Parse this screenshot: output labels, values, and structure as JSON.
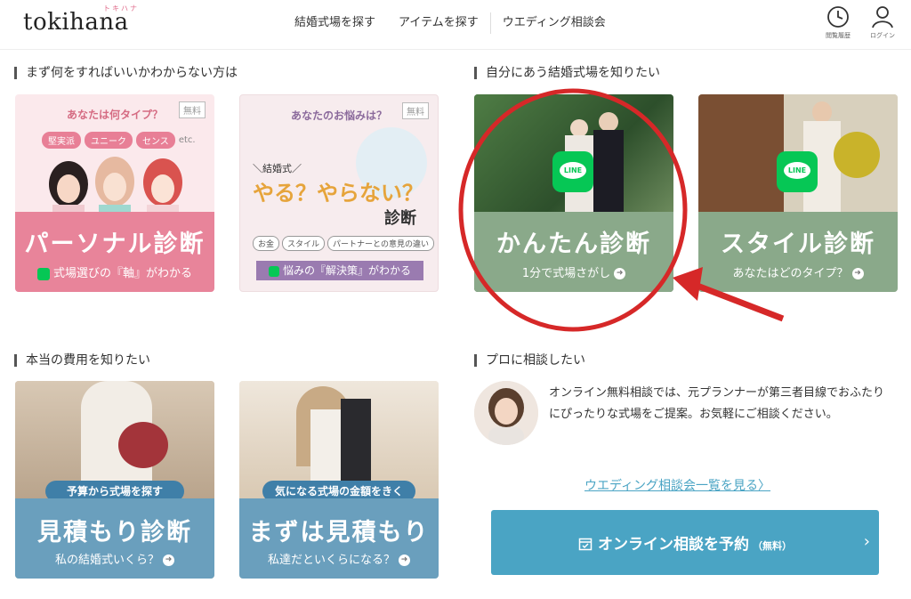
{
  "header": {
    "logo": "tokihana",
    "logo_kana": "トキハナ",
    "nav": [
      "結婚式場を探す",
      "アイテムを探す",
      "ウエディング相談会"
    ],
    "history_label": "閲覧履歴",
    "login_label": "ログイン"
  },
  "sections": {
    "first": "まず何をすればいいかわからない方は",
    "venue": "自分にあう結婚式場を知りたい",
    "cost": "本当の費用を知りたい",
    "pro": "プロに相談したい"
  },
  "cards": {
    "personal": {
      "question": "あなたは何タイプ？",
      "free": "無料",
      "tags": [
        "堅実派",
        "ユニーク",
        "センス"
      ],
      "etc": "etc.",
      "title": "パーソナル診断",
      "sub": "式場選びの『軸』がわかる"
    },
    "worry": {
      "question": "あなたのお悩みは？",
      "free": "無料",
      "kicker": "＼結婚式／",
      "headline": "やる？やらない？",
      "diag": "診断",
      "tags": [
        "お金",
        "スタイル",
        "パートナーとの意見の違い"
      ],
      "sub": "悩みの『解決策』がわかる"
    },
    "easy": {
      "line": "LINE",
      "title": "かんたん診断",
      "sub": "1分で式場さがし"
    },
    "style": {
      "line": "LINE",
      "title": "スタイル診断",
      "sub": "あなたはどのタイプ？"
    },
    "estimate": {
      "pill": "予算から式場を探す",
      "title": "見積もり診断",
      "sub": "私の結婚式いくら？"
    },
    "first_estimate": {
      "pill": "気になる式場の金額をきく",
      "title": "まずは見積もり",
      "sub": "私達だといくらになる？"
    }
  },
  "consult": {
    "text": "オンライン無料相談では、元プランナーが第三者目線でおふたりにぴったりな式場をご提案。お気軽にご相談ください。",
    "link": "ウエディング相談会一覧を見る",
    "cta": "オンライン相談を予約",
    "cta_free": "（無料）"
  },
  "colors": {
    "pink_band": "#e8849a",
    "green_band": "#8aa98a",
    "blue_band": "#6a9fbd",
    "cta": "#4aa4c4",
    "annotation": "#d62828",
    "line": "#06c755"
  },
  "icons": [
    "clock-icon",
    "person-icon",
    "line-icon",
    "arrow-circle-icon",
    "calendar-check-icon",
    "chevron-right-icon"
  ]
}
